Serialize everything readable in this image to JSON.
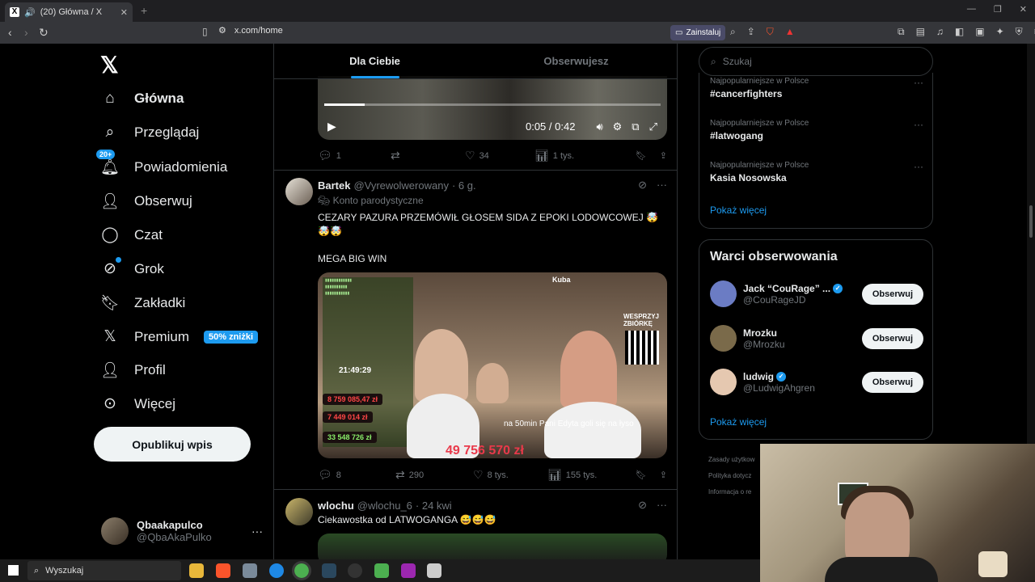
{
  "browser": {
    "tab_title": "(20) Główna / X",
    "url": "x.com/home",
    "install_label": "Zainstaluj"
  },
  "nav": {
    "items": [
      {
        "label": "Główna",
        "icon": "home-icon"
      },
      {
        "label": "Przeglądaj",
        "icon": "search-icon"
      },
      {
        "label": "Powiadomienia",
        "icon": "bell-icon",
        "badge": "20+"
      },
      {
        "label": "Obserwuj",
        "icon": "person-add-icon"
      },
      {
        "label": "Czat",
        "icon": "chat-icon"
      },
      {
        "label": "Grok",
        "icon": "grok-icon"
      },
      {
        "label": "Zakładki",
        "icon": "bookmark-icon"
      },
      {
        "label": "Premium",
        "icon": "x-icon",
        "badge": "50% zniżki"
      },
      {
        "label": "Profil",
        "icon": "profile-icon"
      },
      {
        "label": "Więcej",
        "icon": "more-icon"
      }
    ],
    "post_button": "Opublikuj wpis",
    "profile": {
      "name": "Qbaakapulco",
      "handle": "@QbaAkaPulko"
    }
  },
  "feed": {
    "tabs": [
      "Dla Ciebie",
      "Obserwujesz"
    ],
    "video": {
      "time": "0:05 / 0:42",
      "progress": 0.12
    },
    "tweet1_actions": {
      "replies": "1",
      "retweets": "",
      "likes": "34",
      "views": "1 tys."
    },
    "tweet2": {
      "name": "Bartek",
      "handle": "@Vyrewolwerowany",
      "time": "· 6 g.",
      "parody": "Konto parodystyczne",
      "text1": "CEZARY PAZURA PRZEMÓWIŁ GŁOSEM SIDA Z EPOKI LODOWCOWEJ 🤯",
      "text2": "🤯🤯",
      "text3": "MEGA BIG WIN",
      "media": {
        "kuba": "Kuba",
        "clock": "21:49:29",
        "amt1": "8 759 085,47 zł",
        "amt2": "7 449 014 zł",
        "amt3": "33 548 726 zł",
        "big": "49 756 570 zł",
        "caption": "na 50min Pani Edyta goli się na łyso",
        "wesprzyj": "WESPRZYJ ZBIÓRKĘ"
      },
      "actions": {
        "replies": "8",
        "retweets": "290",
        "likes": "8 tys.",
        "views": "155 tys."
      }
    },
    "tweet3": {
      "name": "wlochu",
      "handle": "@wlochu_6",
      "time": "· 24 kwi",
      "text": "Ciekawostka od LATWOGANGA 😅😅😅"
    }
  },
  "right": {
    "search_placeholder": "Szukaj",
    "trends": [
      {
        "context": "Najpopularniejsze w Polsce",
        "tag": "#cancerfighters"
      },
      {
        "context": "Najpopularniejsze w Polsce",
        "tag": "#latwogang"
      },
      {
        "context": "Najpopularniejsze w Polsce",
        "tag": "Kasia Nosowska"
      }
    ],
    "show_more": "Pokaż więcej",
    "wto_title": "Warci obserwowania",
    "accounts": [
      {
        "name": "Jack “CouRage” ...",
        "handle": "@CouRageJD",
        "verified": true,
        "color": "#6b7cc4"
      },
      {
        "name": "Mrozku",
        "handle": "@Mrozku",
        "verified": false,
        "color": "#7a6a4a"
      },
      {
        "name": "ludwig",
        "handle": "@LudwigAhgren",
        "verified": true,
        "color": "#e5c8b0"
      }
    ],
    "follow_label": "Obserwuj",
    "footer": [
      "Zasady użytkow",
      "Polityka dotycz",
      "Informacja o re"
    ]
  },
  "taskbar": {
    "search": "Wyszukaj"
  }
}
